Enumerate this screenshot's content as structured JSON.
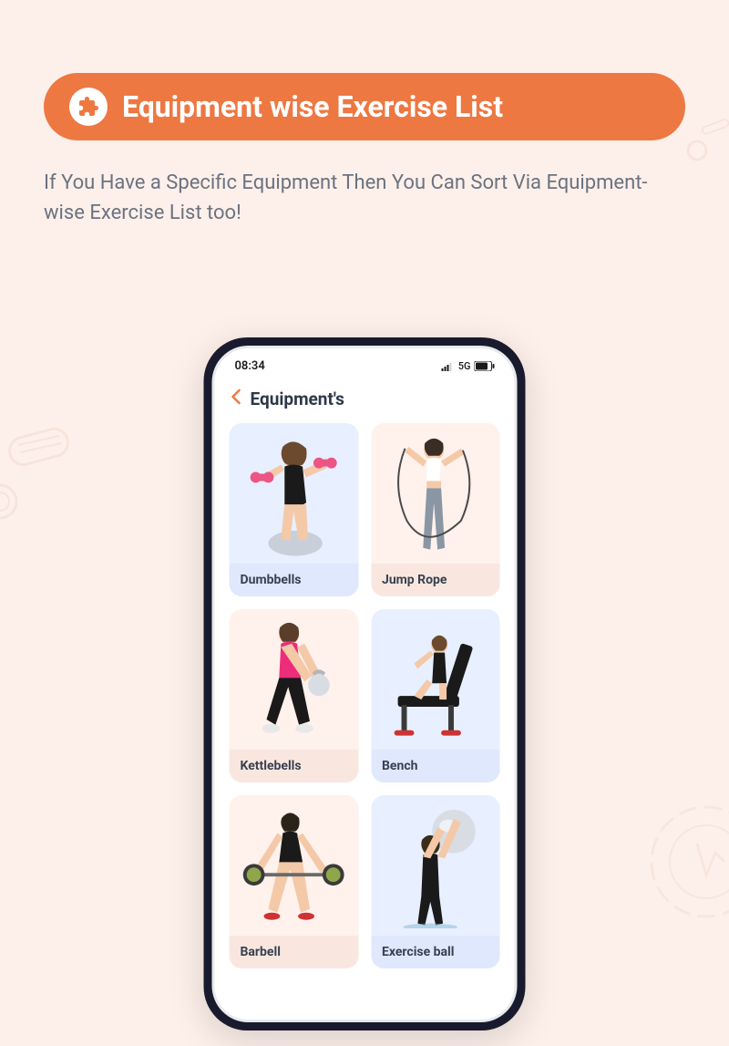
{
  "header": {
    "title": "Equipment wise Exercise List"
  },
  "subtitle": "If You Have a Specific Equipment Then You Can Sort Via Equipment-wise Exercise List too!",
  "phone": {
    "status_time": "08:34",
    "status_net": "5G",
    "app_title": "Equipment's",
    "cards": [
      {
        "label": "Dumbbells"
      },
      {
        "label": "Jump Rope"
      },
      {
        "label": "Kettlebells"
      },
      {
        "label": "Bench"
      },
      {
        "label": "Barbell"
      },
      {
        "label": "Exercise ball"
      }
    ]
  }
}
